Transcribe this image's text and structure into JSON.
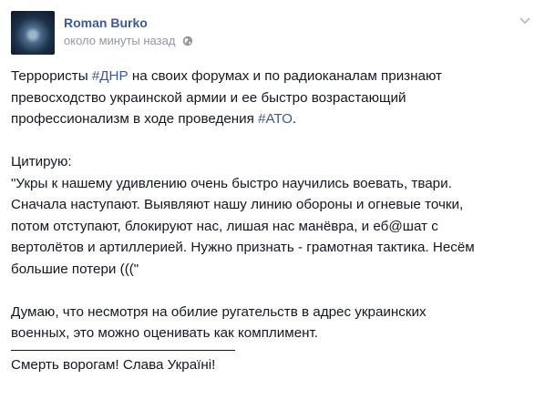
{
  "post": {
    "author": "Roman Burko",
    "timestamp": "около минуты назад",
    "icons": {
      "privacy": "globe-icon",
      "menu": "chevron-down-icon"
    },
    "paragraph1": {
      "t1": "Террористы ",
      "tag1": "#ДНР",
      "t2": " на своих форумах и по радиоканалам признают",
      "line2": "превосходство украинской армии и ее быстро возрастающий",
      "t3": "профессионализм в ходе проведения ",
      "tag2": "#АТО",
      "t4": "."
    },
    "quote": {
      "intro": "Цитирую:",
      "line1": "\"Укры к нашему удивлению очень быстро научились воевать, твари.",
      "line2": "Сначала наступают. Выявляют нашу линию обороны и огневые точки,",
      "line3": "потом отступают, блокируют нас, лишая нас манёвра, и еб@шат с",
      "line4": "вертолётов и артиллерией. Нужно признать - грамотная тактика. Несём",
      "line5": "большие потери (((\""
    },
    "comment": {
      "line1": "Думаю, что несмотря на обилие ругательств в адрес украинских",
      "line2": "военных, это можно оценивать как комплимент."
    },
    "closing": "Смерть ворогам! Слава Україні!"
  }
}
